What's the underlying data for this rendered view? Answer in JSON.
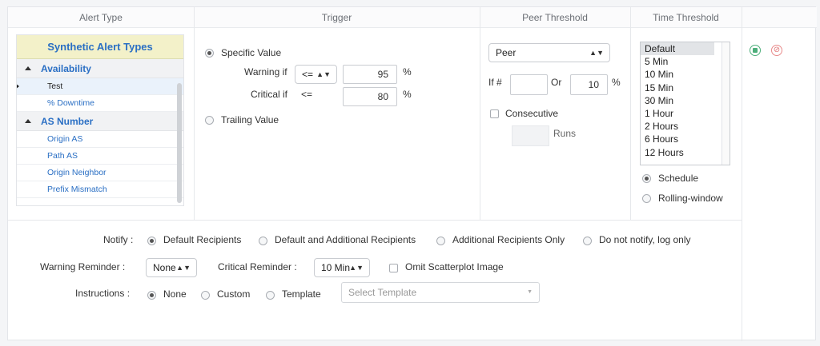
{
  "headers": {
    "alert_type": "Alert Type",
    "trigger": "Trigger",
    "peer_threshold": "Peer Threshold",
    "time_threshold": "Time Threshold"
  },
  "tree": {
    "title": "Synthetic Alert Types",
    "groups": [
      {
        "label": "Availability",
        "items": [
          "Test",
          "% Downtime"
        ]
      },
      {
        "label": "AS Number",
        "items": [
          "Origin AS",
          "Path AS",
          "Origin Neighbor",
          "Prefix Mismatch"
        ]
      }
    ],
    "selected": "Test"
  },
  "trigger": {
    "specific_value": "Specific Value",
    "warning_label": "Warning if",
    "warning_op": "<=",
    "warning_value": "95",
    "warning_unit": "%",
    "critical_label": "Critical if",
    "critical_op": "<=",
    "critical_value": "80",
    "critical_unit": "%",
    "trailing_value": "Trailing Value"
  },
  "peer": {
    "select": "Peer",
    "if_label": "If #",
    "if_value": "",
    "or_label": "Or",
    "or_value": "10",
    "pct": "%",
    "consecutive": "Consecutive",
    "runs_value": "",
    "runs": "Runs"
  },
  "time": {
    "options": [
      "Default",
      "5 Min",
      "10 Min",
      "15 Min",
      "30 Min",
      "1 Hour",
      "2 Hours",
      "6 Hours",
      "12 Hours"
    ],
    "schedule": "Schedule",
    "rolling": "Rolling-window"
  },
  "notify": {
    "label": "Notify :",
    "opt1": "Default Recipients",
    "opt2": "Default and Additional Recipients",
    "opt3": "Additional Recipients Only",
    "opt4": "Do not notify, log only"
  },
  "reminders": {
    "warning_label": "Warning Reminder :",
    "warning_value": "None",
    "critical_label": "Critical Reminder :",
    "critical_value": "10 Min",
    "omit": "Omit Scatterplot Image"
  },
  "instructions": {
    "label": "Instructions :",
    "none": "None",
    "custom": "Custom",
    "template": "Template",
    "select_placeholder": "Select Template"
  },
  "icons": {
    "save": "save-icon",
    "cancel": "cancel-icon"
  }
}
